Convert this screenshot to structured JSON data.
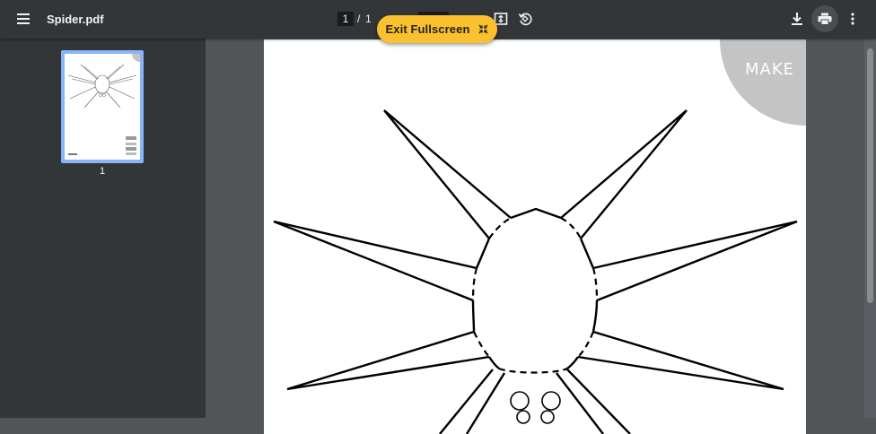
{
  "toolbar": {
    "title": "Spider.pdf",
    "current_page": "1",
    "page_separator": "/",
    "total_pages": "1"
  },
  "fullscreen": {
    "exit_label": "Exit Fullscreen"
  },
  "sidebar": {
    "thumbnails": [
      {
        "page_number": "1"
      }
    ]
  },
  "page": {
    "watermark": "MAKE"
  },
  "icons": {
    "menu": "hamburger-menu-icon",
    "fit": "fit-to-page-icon",
    "rotate": "rotate-icon",
    "download": "download-icon",
    "print": "print-icon",
    "more": "more-vert-icon",
    "exit_fullscreen": "exit-fullscreen-icon"
  },
  "colors": {
    "toolbar_bg": "#323639",
    "viewer_bg": "#525659",
    "pill_bg": "#fbc02d",
    "thumb_selected": "#8ab4f8",
    "watermark_circle": "#c4c4c4"
  }
}
